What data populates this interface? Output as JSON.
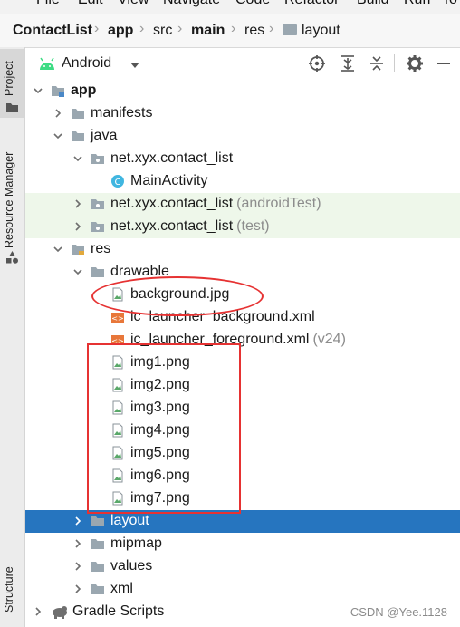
{
  "menubar": {
    "items": [
      "File",
      "Edit",
      "View",
      "Navigate",
      "Code",
      "Refactor",
      "Build",
      "Run",
      "To"
    ]
  },
  "breadcrumb": {
    "items": [
      "ContactList",
      "app",
      "src",
      "main",
      "res",
      "layout"
    ]
  },
  "side_tabs": {
    "project": "Project",
    "resource_manager": "Resource Manager",
    "structure": "Structure"
  },
  "project_panel": {
    "view_mode": "Android",
    "toolbar_icons": [
      "target-icon",
      "expand-all-icon",
      "collapse-all-icon",
      "gear-icon",
      "minimize-icon"
    ]
  },
  "tree": [
    {
      "label": "app",
      "bold": true,
      "icon": "module-folder",
      "expanded": true
    },
    {
      "label": "manifests",
      "icon": "folder",
      "expanded": false
    },
    {
      "label": "java",
      "icon": "folder",
      "expanded": true
    },
    {
      "label": "net.xyx.contact_list",
      "icon": "package",
      "expanded": true
    },
    {
      "label": "MainActivity",
      "icon": "class"
    },
    {
      "label": "net.xyx.contact_list",
      "suffix": "(androidTest)",
      "icon": "package",
      "expanded": false
    },
    {
      "label": "net.xyx.contact_list",
      "suffix": "(test)",
      "icon": "package",
      "expanded": false
    },
    {
      "label": "res",
      "icon": "res-folder",
      "expanded": true
    },
    {
      "label": "drawable",
      "icon": "folder",
      "expanded": true
    },
    {
      "label": "background.jpg",
      "icon": "image-file"
    },
    {
      "label": "ic_launcher_background.xml",
      "icon": "xml-file"
    },
    {
      "label": "ic_launcher_foreground.xml",
      "suffix": "(v24)",
      "icon": "xml-file"
    },
    {
      "label": "img1.png",
      "icon": "image-file"
    },
    {
      "label": "img2.png",
      "icon": "image-file"
    },
    {
      "label": "img3.png",
      "icon": "image-file"
    },
    {
      "label": "img4.png",
      "icon": "image-file"
    },
    {
      "label": "img5.png",
      "icon": "image-file"
    },
    {
      "label": "img6.png",
      "icon": "image-file"
    },
    {
      "label": "img7.png",
      "icon": "image-file"
    },
    {
      "label": "layout",
      "icon": "folder",
      "expanded": false,
      "selected": true
    },
    {
      "label": "mipmap",
      "icon": "folder",
      "expanded": false
    },
    {
      "label": "values",
      "icon": "folder",
      "expanded": false
    },
    {
      "label": "xml",
      "icon": "folder",
      "expanded": false
    },
    {
      "label": "Gradle Scripts",
      "icon": "gradle",
      "expanded": false
    }
  ],
  "watermark": "CSDN @Yee.1128",
  "colors": {
    "selection": "#2675bf",
    "annotation": "#e63232",
    "test_row": "#eef7ea",
    "folder": "#9aa7b0",
    "android": "#3ddc84"
  }
}
